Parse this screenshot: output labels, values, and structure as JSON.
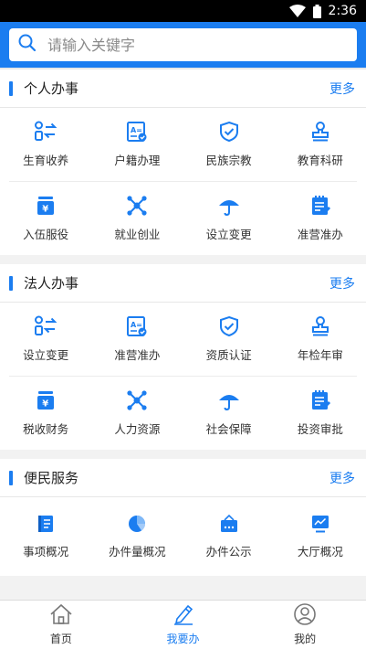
{
  "status_bar": {
    "time": "2:36",
    "icons": [
      "wifi-icon",
      "battery-icon"
    ]
  },
  "search": {
    "placeholder": "请输入关键字"
  },
  "accent_color": "#1b7df0",
  "sections": [
    {
      "title": "个人办事",
      "more": "更多",
      "items": [
        {
          "label": "生育收养",
          "icon": "person-swap-icon"
        },
        {
          "label": "户籍办理",
          "icon": "id-card-icon"
        },
        {
          "label": "民族宗教",
          "icon": "shield-check-icon"
        },
        {
          "label": "教育科研",
          "icon": "stamp-icon"
        },
        {
          "label": "入伍服役",
          "icon": "money-stack-icon"
        },
        {
          "label": "就业创业",
          "icon": "network-icon"
        },
        {
          "label": "设立变更",
          "icon": "umbrella-icon"
        },
        {
          "label": "准营准办",
          "icon": "notepad-icon"
        }
      ]
    },
    {
      "title": "法人办事",
      "more": "更多",
      "items": [
        {
          "label": "设立变更",
          "icon": "person-swap-icon"
        },
        {
          "label": "准营准办",
          "icon": "id-card-icon"
        },
        {
          "label": "资质认证",
          "icon": "shield-check-icon"
        },
        {
          "label": "年检年审",
          "icon": "stamp-icon"
        },
        {
          "label": "税收财务",
          "icon": "money-stack-icon"
        },
        {
          "label": "人力资源",
          "icon": "network-icon"
        },
        {
          "label": "社会保障",
          "icon": "umbrella-icon"
        },
        {
          "label": "投资审批",
          "icon": "notepad-icon"
        }
      ]
    },
    {
      "title": "便民服务",
      "more": "更多",
      "items": [
        {
          "label": "事项概况",
          "icon": "list-book-icon"
        },
        {
          "label": "办件量概况",
          "icon": "pie-chart-icon"
        },
        {
          "label": "办件公示",
          "icon": "notice-board-icon"
        },
        {
          "label": "大厅概况",
          "icon": "monitor-chart-icon"
        }
      ]
    }
  ],
  "bottom_nav": [
    {
      "label": "首页",
      "icon": "home-icon",
      "active": false
    },
    {
      "label": "我要办",
      "icon": "pencil-icon",
      "active": true
    },
    {
      "label": "我的",
      "icon": "user-icon",
      "active": false
    }
  ]
}
